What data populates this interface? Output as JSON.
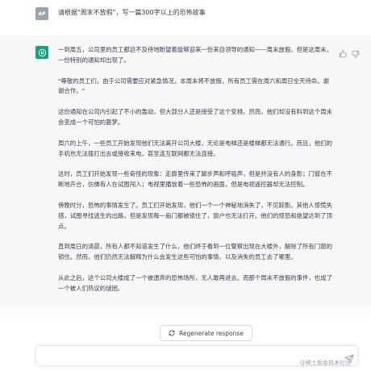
{
  "user": {
    "avatar_text": "AP",
    "message": "请根据\"周末不放假\"，写一篇300字以上的恐怖故事"
  },
  "assistant": {
    "paragraphs": [
      "一到周五，公司里的员工都迫不及待地盼望着能够迎来一份来自领导的通知——周末放假。但是这周末，一份特别的通知却出现了。",
      "\"尊敬的员工们，由于公司需要应对紧急情况，本周末将不放假，所有员工需在周六和周日全天待命。谢谢合作。\"",
      "这份通知在公司内引起了不小的轰动，但大部分人还是接受了这个安排。然而，他们却没有料到这个周末会变成一个可怕的噩梦。",
      "周六的上午，一些员工开始发现他们无法离开公司大楼，无论是电梯还是楼梯都无法通行。而且，他们的手机也无法拨打出去或接收来电，甚至连互联网都无法连接。",
      "这时，员工们开始发现一些奇怪的现象：走廊里传来了脚步声和呼吸声，但是并没有人的身影；门窗在不断地开合，仿佛有人在试图闯入；电视里播放着一些恐怖的画面，但是电视遥控器却无法控制。",
      "傍晚时分，恐怖的事情发生了。员工们开始发现，他们一个一个神秘地消失了，不见踪影。其他人惊慌失措，试图寻找逃生的出路，但是发现每一扇门都被锁住了，窗户也无法打开。他们的惊恐和绝望达到了顶点。",
      "直到周日的清晨，所有人都不知道发生了什么，他们终于看到一位警察出现在大楼外，解除了所有门窗的锁住。然而，他们仍然无法解释为什么会发生这些可怕的事情，以及消失的员工去了哪里。",
      "从此之后，这个公司大楼成了一个被遗弃的恐怖场所，无人敢再进去。而那个周末不放假的事件，也成了一个被人们热议的谜团。"
    ]
  },
  "regenerate_label": "Regenerate response",
  "input": {
    "placeholder": ""
  },
  "watermark": "@稀土掘金技术社区",
  "colors": {
    "brand": "#10a37f",
    "user_avatar": "#9aa4ae"
  },
  "icons": [
    "openai-logo-icon",
    "thumbs-up-icon",
    "thumbs-down-icon",
    "refresh-icon",
    "send-icon"
  ]
}
